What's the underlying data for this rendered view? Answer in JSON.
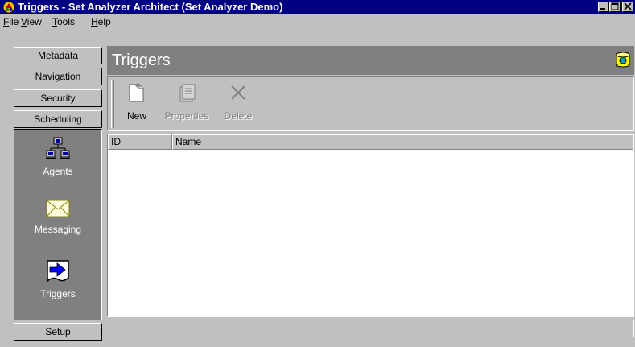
{
  "window": {
    "title": "Triggers - Set Analyzer Architect (Set Analyzer Demo)",
    "icon": "app-icon"
  },
  "menu": [
    {
      "underline": "F",
      "rest": "ile"
    },
    {
      "underline": "V",
      "rest": "iew"
    },
    {
      "underline": "T",
      "rest": "ools"
    },
    {
      "underline": "H",
      "rest": "elp"
    }
  ],
  "nav": {
    "buttons": [
      "Metadata",
      "Navigation",
      "Security",
      "Scheduling"
    ],
    "panel_items": [
      {
        "label": "Agents",
        "icon": "agents-icon"
      },
      {
        "label": "Messaging",
        "icon": "envelope-icon"
      },
      {
        "label": "Triggers",
        "icon": "triggers-icon"
      }
    ],
    "bottom_button": "Setup"
  },
  "header": {
    "title": "Triggers",
    "icon": "database-icon"
  },
  "toolbar": {
    "new_label": "New",
    "properties_label": "Properties",
    "delete_label": "Delete"
  },
  "list": {
    "columns": [
      "ID",
      "Name"
    ],
    "rows": []
  },
  "colors": {
    "titlebar": "#000080",
    "face": "#c0c0c0",
    "panel": "#808080"
  }
}
